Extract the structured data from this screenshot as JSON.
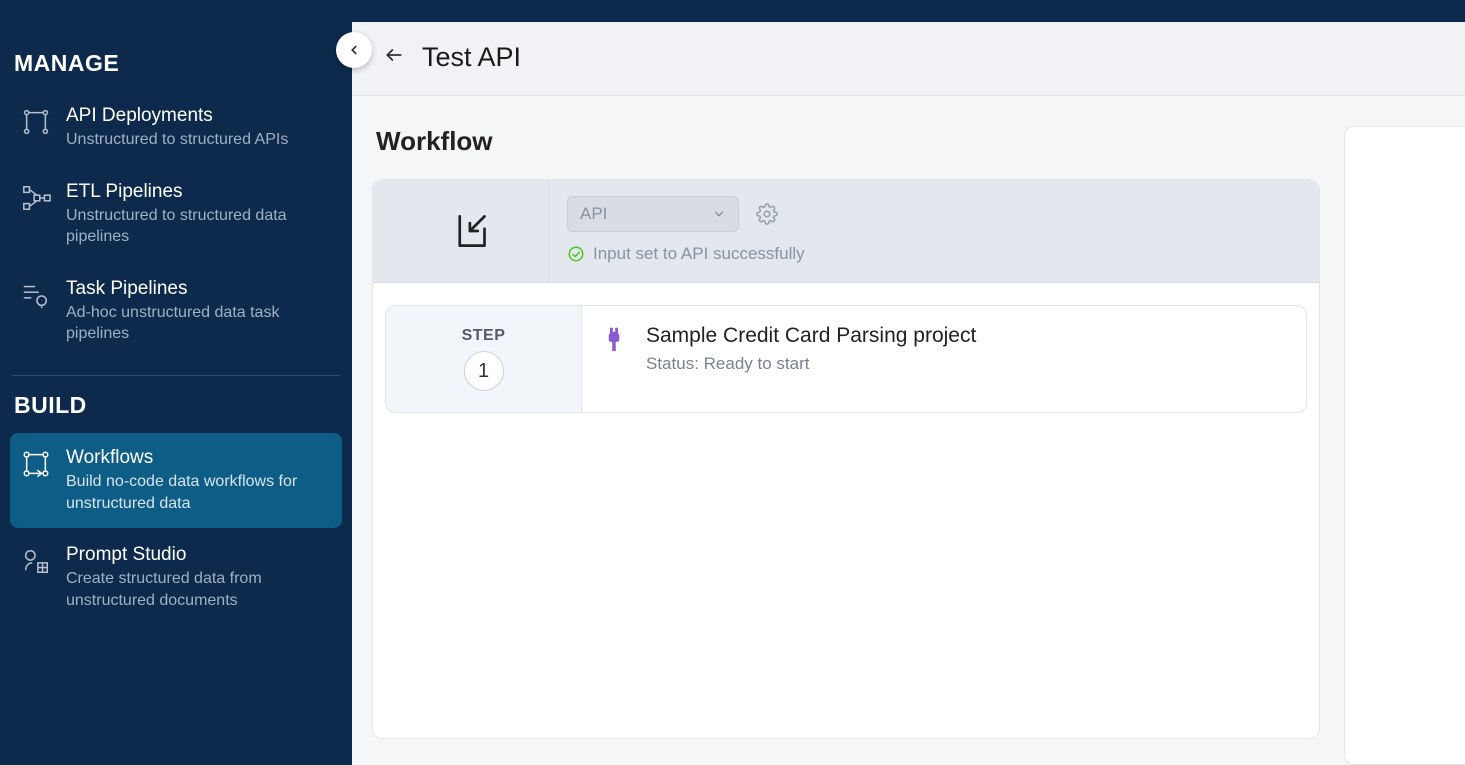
{
  "sidebar": {
    "sections": [
      {
        "label": "MANAGE",
        "items": [
          {
            "title": "API Deployments",
            "desc": "Unstructured to structured APIs",
            "active": false
          },
          {
            "title": "ETL Pipelines",
            "desc": "Unstructured to structured data pipelines",
            "active": false
          },
          {
            "title": "Task Pipelines",
            "desc": "Ad-hoc unstructured data task pipelines",
            "active": false
          }
        ]
      },
      {
        "label": "BUILD",
        "items": [
          {
            "title": "Workflows",
            "desc": "Build no-code data workflows for unstructured data",
            "active": true
          },
          {
            "title": "Prompt Studio",
            "desc": "Create structured data from unstructured documents",
            "active": false
          }
        ]
      }
    ]
  },
  "page": {
    "title": "Test API"
  },
  "workflow": {
    "heading": "Workflow",
    "input": {
      "selected": "API",
      "success_msg": "Input set to API successfully"
    },
    "step": {
      "label": "STEP",
      "num": "1",
      "name": "Sample Credit Card Parsing project",
      "status": "Status: Ready to start"
    }
  }
}
